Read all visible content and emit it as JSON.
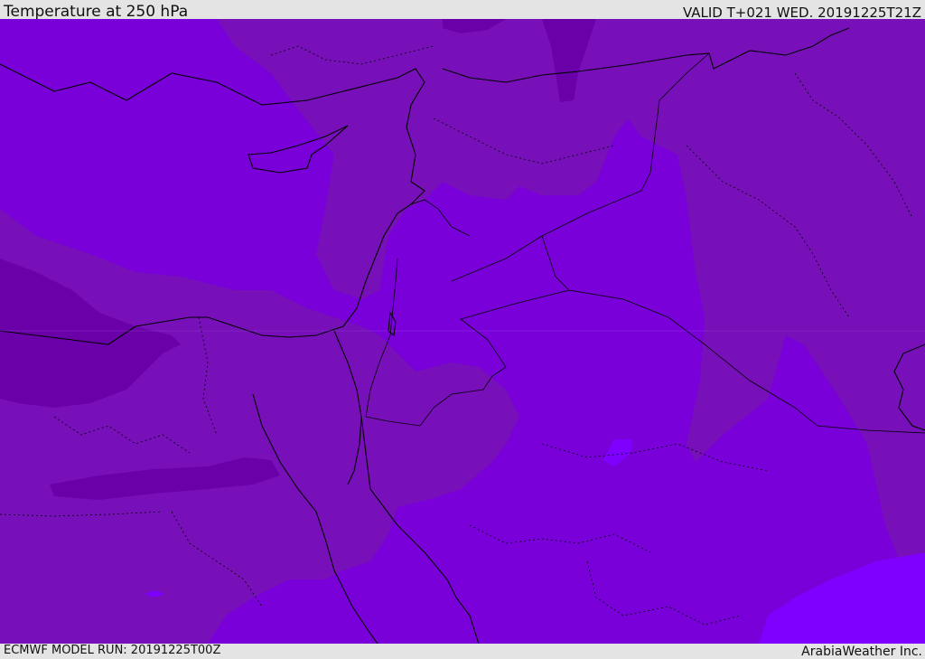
{
  "header": {
    "title": "Temperature at 250 hPa",
    "valid_time": "VALID T+021 WED. 20191225T21Z"
  },
  "footer": {
    "model_run": "ECMWF MODEL RUN: 20191225T00Z",
    "credit": "ArabiaWeather Inc."
  },
  "map": {
    "parameter": "Temperature",
    "level_hpa": 250,
    "colors": {
      "coldest": "#6a00a8",
      "cold": "#7710b8",
      "cool": "#7a00d9",
      "mild": "#7f00ff",
      "outline": "#000000"
    }
  }
}
